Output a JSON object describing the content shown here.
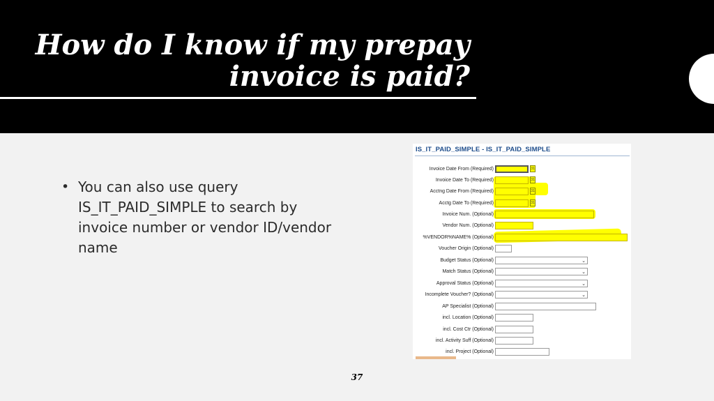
{
  "slide": {
    "title_line1": "How do I know if my prepay",
    "title_line2": "invoice is paid?",
    "bullets": [
      "You can also use query IS_IT_PAID_SIMPLE to search by invoice number or vendor ID/vendor name"
    ],
    "page_number": "37"
  },
  "form": {
    "title": "IS_IT_PAID_SIMPLE - IS_IT_PAID_SIMPLE",
    "highlight_color": "#ffff00",
    "calendar_icon": "calendar-icon",
    "fields": [
      {
        "label": "Invoice Date From (Required)",
        "value": ""
      },
      {
        "label": "Invoice Date To (Required)",
        "value": ""
      },
      {
        "label": "Acctng Date From (Required)",
        "value": ""
      },
      {
        "label": "Acctg Date To (Required)",
        "value": ""
      },
      {
        "label": "Invoice Num. (Optional)",
        "value": ""
      },
      {
        "label": "Vendor Num. (Optional)",
        "value": ""
      },
      {
        "label": "%VENDOR%NAME% (Optional)",
        "value": ""
      },
      {
        "label": "Voucher Origin (Optional)",
        "value": ""
      },
      {
        "label": "Budget Status (Optional)",
        "value": ""
      },
      {
        "label": "Match Status (Optional)",
        "value": ""
      },
      {
        "label": "Approval Status (Optional)",
        "value": ""
      },
      {
        "label": "Incomplete Voucher? (Optional)",
        "value": ""
      },
      {
        "label": "AP Specialist (Optional)",
        "value": ""
      },
      {
        "label": "incl. Location (Optional)",
        "value": ""
      },
      {
        "label": "incl. Cost Ctr (Optional)",
        "value": ""
      },
      {
        "label": "incl. Activity Suff (Optional)",
        "value": ""
      },
      {
        "label": "incl. Project (Optional)",
        "value": ""
      }
    ]
  }
}
